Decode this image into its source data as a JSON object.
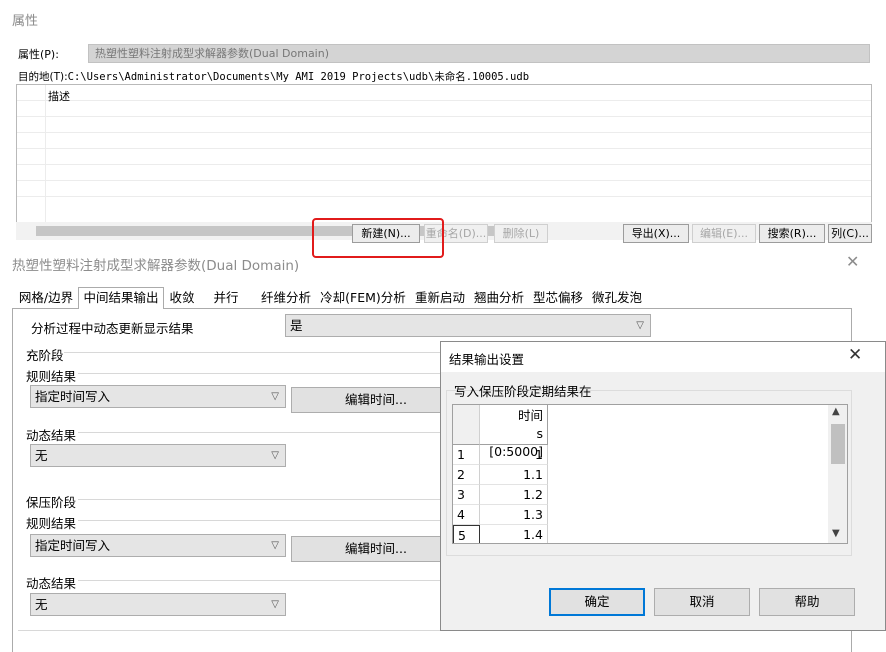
{
  "top_window": {
    "title": "属性",
    "property_label": "属性(P):",
    "property_value": "热塑性塑料注射成型求解器参数(Dual Domain)",
    "destination_label": "目的地(T):",
    "destination_path": "C:\\Users\\Administrator\\Documents\\My AMI 2019 Projects\\udb\\未命名.10005.udb",
    "list_column": "描述",
    "buttons": {
      "new": "新建(N)...",
      "rename": "重命名(D)...",
      "delete": "删除(L)",
      "export": "导出(X)...",
      "edit": "编辑(E)...",
      "search": "搜索(R)...",
      "columns": "列(C)..."
    }
  },
  "solver_window": {
    "title": "热塑性塑料注射成型求解器参数(Dual Domain)",
    "tabs": [
      "网格/边界",
      "中间结果输出",
      "收敛",
      "并行",
      "纤维分析",
      "冷却(FEM)分析",
      "重新启动",
      "翘曲分析",
      "型芯偏移",
      "微孔发泡"
    ],
    "active_tab": "中间结果输出",
    "dynamic_update_label": "分析过程中动态更新显示结果",
    "dynamic_update_value": "是",
    "fill_section": "充阶段",
    "regular_results": "规则结果",
    "write_mode": "指定时间写入",
    "edit_time": "编辑时间...",
    "dynamic_results": "动态结果",
    "dynamic_value": "无",
    "pack_section": "保压阶段"
  },
  "result_dialog": {
    "title": "结果输出设置",
    "group_title": "写入保压阶段定期结果在",
    "column_header_line1": "时间",
    "column_header_line2": "s [0:5000]",
    "rows": [
      {
        "index": "1",
        "value": "1"
      },
      {
        "index": "2",
        "value": "1.1"
      },
      {
        "index": "3",
        "value": "1.2"
      },
      {
        "index": "4",
        "value": "1.3"
      },
      {
        "index": "5",
        "value": "1.4"
      }
    ],
    "ok": "确定",
    "cancel": "取消",
    "help": "帮助"
  },
  "colors": {
    "highlight": "#e11b1b",
    "focus": "#0078d7"
  }
}
